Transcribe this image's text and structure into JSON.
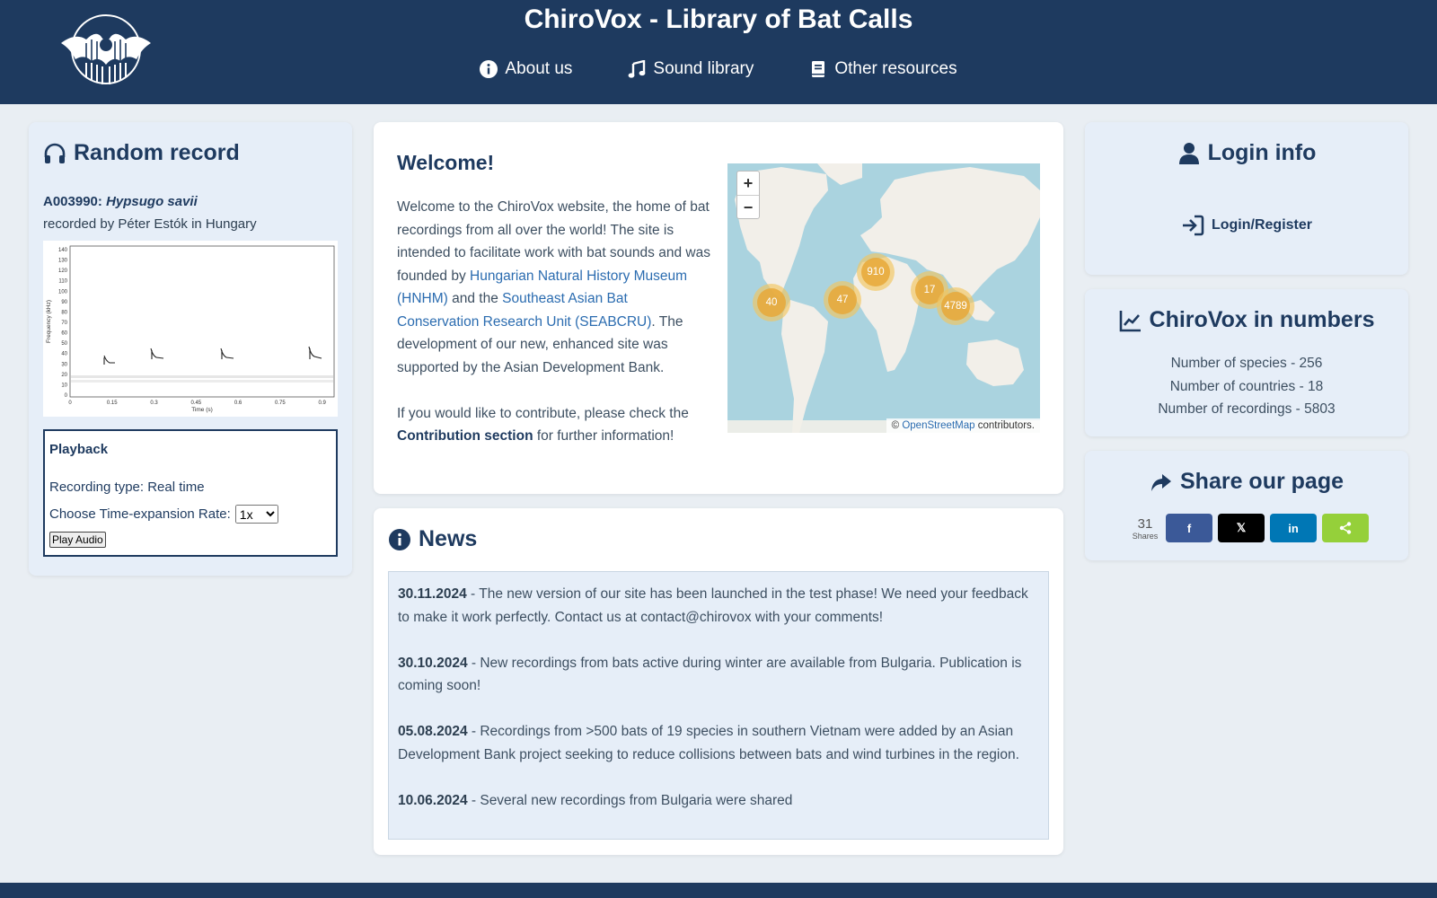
{
  "header": {
    "title": "ChiroVox - Library of Bat Calls",
    "nav": [
      {
        "label": "About us",
        "icon": "info-circle-icon"
      },
      {
        "label": "Sound library",
        "icon": "music-note-icon"
      },
      {
        "label": "Other resources",
        "icon": "book-icon"
      }
    ]
  },
  "random_record": {
    "title": "Random record",
    "id_prefix": "A003990: ",
    "species": "Hypsugo savii",
    "recorded_by": "recorded by Péter Estók in Hungary",
    "spectrogram": {
      "ylabel": "Frequency (kHz)",
      "xlabel": "Time (s)",
      "yticks": [
        "0",
        "10",
        "20",
        "30",
        "40",
        "50",
        "60",
        "70",
        "80",
        "90",
        "100",
        "110",
        "120",
        "130",
        "140"
      ],
      "xticks": [
        "0",
        "0.15",
        "0.3",
        "0.45",
        "0.6",
        "0.75",
        "0.9"
      ]
    },
    "playback": {
      "title": "Playback",
      "type": "Recording type: Real time",
      "rate_label": "Choose Time-expansion Rate:",
      "rate_value": "1x",
      "play_label": "Play Audio"
    }
  },
  "welcome": {
    "title": "Welcome!",
    "p1_a": "Welcome to the ChiroVox website, the home of bat recordings from all over the world! The site is intended to facilitate work with bat sounds and was founded by ",
    "link1": "Hungarian Natural History Museum (HNHM)",
    "p1_b": " and the ",
    "link2": "Southeast Asian Bat Conservation Research Unit (SEABCRU)",
    "p1_c": ". The development of our new, enhanced site was supported by the Asian Development Bank.",
    "p2_a": "If you would like to contribute, please check the ",
    "p2_link": "Contribution section",
    "p2_b": " for further information!",
    "map": {
      "zoom_in": "+",
      "zoom_out": "−",
      "attrib_prefix": "© ",
      "attrib_link": "OpenStreetMap",
      "attrib_suffix": " contributors.",
      "clusters": [
        {
          "label": "40",
          "cls": "c1"
        },
        {
          "label": "47",
          "cls": "c2"
        },
        {
          "label": "910",
          "cls": "c3"
        },
        {
          "label": "17",
          "cls": "c4"
        },
        {
          "label": "4789",
          "cls": "c5"
        }
      ]
    }
  },
  "news": {
    "title": "News",
    "items": [
      {
        "date": "30.11.2024",
        "text": " - The new version of our site has been launched in the test phase! We need your feedback to make it work perfectly. Contact us at contact@chirovox with your comments!"
      },
      {
        "date": "30.10.2024",
        "text": " - New recordings from bats active during winter are available from Bulgaria. Publication is coming soon!"
      },
      {
        "date": "05.08.2024",
        "text": " - Recordings from >500 bats of 19 species in southern Vietnam were added by an Asian Development Bank project seeking to reduce collisions between bats and wind turbines in the region."
      },
      {
        "date": "10.06.2024",
        "text": " - Several new recordings from Bulgaria were shared"
      }
    ]
  },
  "login": {
    "title": "Login info",
    "button": "Login/Register"
  },
  "numbers": {
    "title": "ChiroVox in numbers",
    "species": "Number of species - 256",
    "countries": "Number of countries - 18",
    "recordings": "Number of recordings - 5803"
  },
  "share": {
    "title": "Share our page",
    "count": "31",
    "count_label": "Shares",
    "buttons": [
      {
        "name": "facebook",
        "glyph": "f",
        "color": "#3b5998"
      },
      {
        "name": "x",
        "glyph": "𝕏",
        "color": "#000000"
      },
      {
        "name": "linkedin",
        "glyph": "in",
        "color": "#0077b5"
      },
      {
        "name": "sharethis",
        "glyph": "share-icon",
        "color": "#95d03a"
      }
    ]
  },
  "colors": {
    "header_bg": "#1e3a5f",
    "accent": "#1e3a5f",
    "link": "#2b6cb0",
    "panel_blue": "#e6eef8"
  }
}
